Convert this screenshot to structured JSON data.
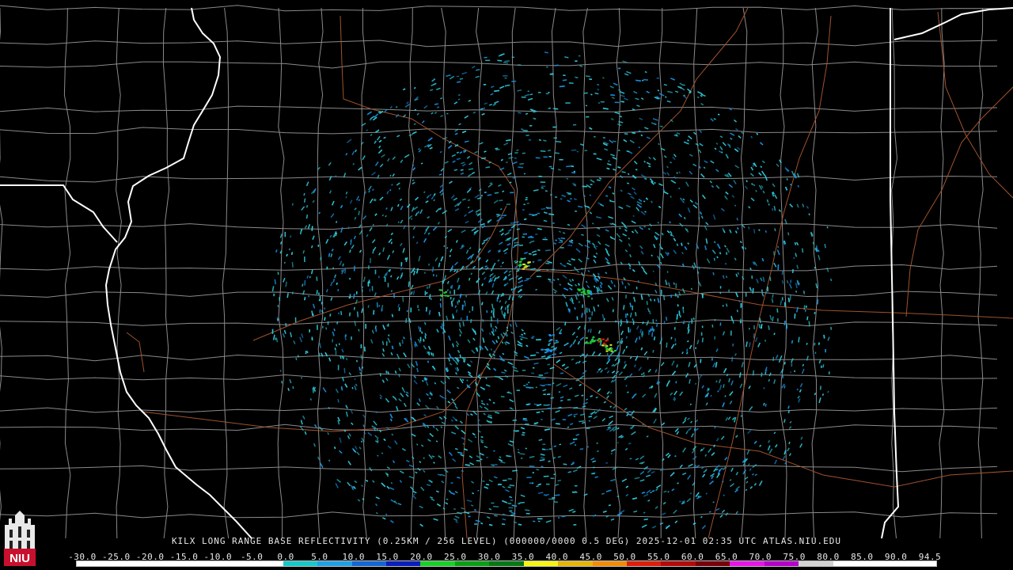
{
  "caption": {
    "text": "KILX LONG RANGE BASE REFLECTIVITY (0.25KM / 256 LEVEL) (000000/0000 0.5 DEG) 2025-12-01 02:35 UTC  ATLAS.NIU.EDU"
  },
  "colorscale": {
    "labels": [
      "-30.0",
      "-25.0",
      "-20.0",
      "-15.0",
      "-10.0",
      "-5.0",
      "0.0",
      "5.0",
      "10.0",
      "15.0",
      "20.0",
      "25.0",
      "30.0",
      "35.0",
      "40.0",
      "45.0",
      "50.0",
      "55.0",
      "60.0",
      "65.0",
      "70.0",
      "75.0",
      "80.0",
      "85.0",
      "90.0",
      "94.5"
    ],
    "colors": [
      "#ffffff",
      "#ffffff",
      "#ffffff",
      "#ffffff",
      "#ffffff",
      "#ffffff",
      "#17c8c8",
      "#1fa0e6",
      "#1466d2",
      "#0a1ebe",
      "#19d228",
      "#0aa014",
      "#087814",
      "#f5f514",
      "#e6b40a",
      "#f08c0a",
      "#dc1e0a",
      "#b40a0a",
      "#78000a",
      "#e614e6",
      "#b400c8",
      "#d2d2d2",
      "#ffffff",
      "#ffffff",
      "#ffffff"
    ]
  },
  "logo": {
    "text": "NIU"
  },
  "map": {
    "radar_site": "KILX",
    "colors": {
      "state_border": "#ffffff",
      "county_line": "#8a8a8a",
      "highway": "#a0522d",
      "echo_low": "#2ec8d8",
      "echo_mid": "#1a8fe0",
      "echo_green": "#22c43a",
      "echo_yellow": "#e8e820",
      "echo_red": "#e02010"
    }
  }
}
